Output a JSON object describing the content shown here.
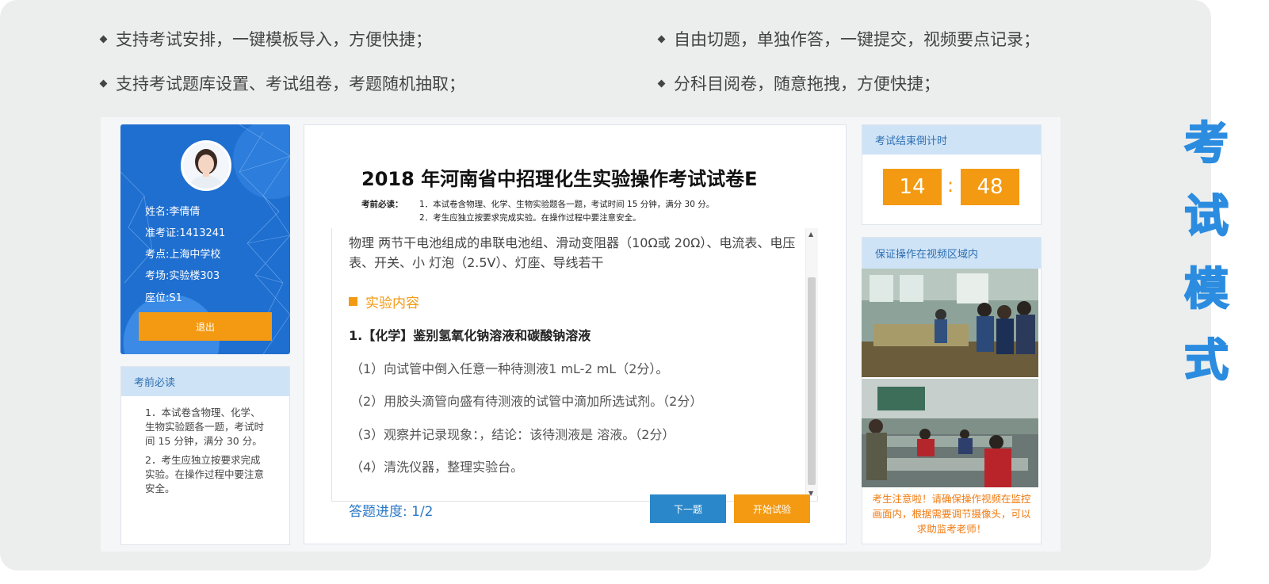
{
  "features": [
    "支持考试安排，一键模板导入，方便快捷；",
    "自由切题，单独作答，一键提交，视频要点记录；",
    "支持考试题库设置、考试组卷，考题随机抽取；",
    "分科目阅卷，随意拖拽，方便快捷；"
  ],
  "student": {
    "name": "姓名:李倩倩",
    "ticket": "准考证:1413241",
    "site": "考点:上海中学校",
    "room": "考场:实验楼303",
    "seat": "座位:S1",
    "logout_label": "退出"
  },
  "notice": {
    "title": "考前必读",
    "item1": "1．本试卷含物理、化学、生物实验题各一题，考试时间 15 分钟，满分 30 分。",
    "item2": "2．考生应独立按要求完成实验。在操作过程中要注意安全。"
  },
  "exam": {
    "title": "2018 年河南省中招理化生实验操作考试试卷E",
    "readme_label": "考前必读：",
    "readme_line1": "1．本试卷含物理、化学、生物实验题各一题，考试时间 15 分钟，满分 30 分。",
    "readme_line2": "2．考生应独立按要求完成实验。在操作过程中要注意安全。",
    "material": "物理 两节干电池组成的串联电池组、滑动变阻器（10Ω或 20Ω）、电流表、电压表、开关、小 灯泡（2.5V）、灯座、导线若干",
    "section_label": "实验内容",
    "question_title": "1.【化学】鉴别氢氧化钠溶液和碳酸钠溶液",
    "steps": [
      "（1）向试管中倒入任意一种待测液1 mL-2 mL（2分）。",
      "（2）用胶头滴管向盛有待测液的试管中滴加所选试剂。（2分）",
      "（3）观察并记录现象：，结论：该待测液是 溶液。（2分）",
      "（4）清洗仪器，整理实验台。"
    ],
    "progress_label": "答题进度:",
    "progress_value": "1/2",
    "next_label": "下一题",
    "start_label": "开始试验"
  },
  "timer": {
    "title": "考试结束倒计时",
    "minutes": "14",
    "colon": ":",
    "seconds": "48"
  },
  "video": {
    "title": "保证操作在视频区域内",
    "warning": "考生注意啦！请确保操作视频在监控画面内，根据需要调节摄像头，可以求助监考老师！"
  },
  "mode_title": [
    "考",
    "试",
    "模",
    "式"
  ],
  "colors": {
    "accent_orange": "#f39a12",
    "accent_blue": "#2b8ce0",
    "card_header": "#cfe3f6",
    "profile_blue": "#1f6fd0"
  }
}
